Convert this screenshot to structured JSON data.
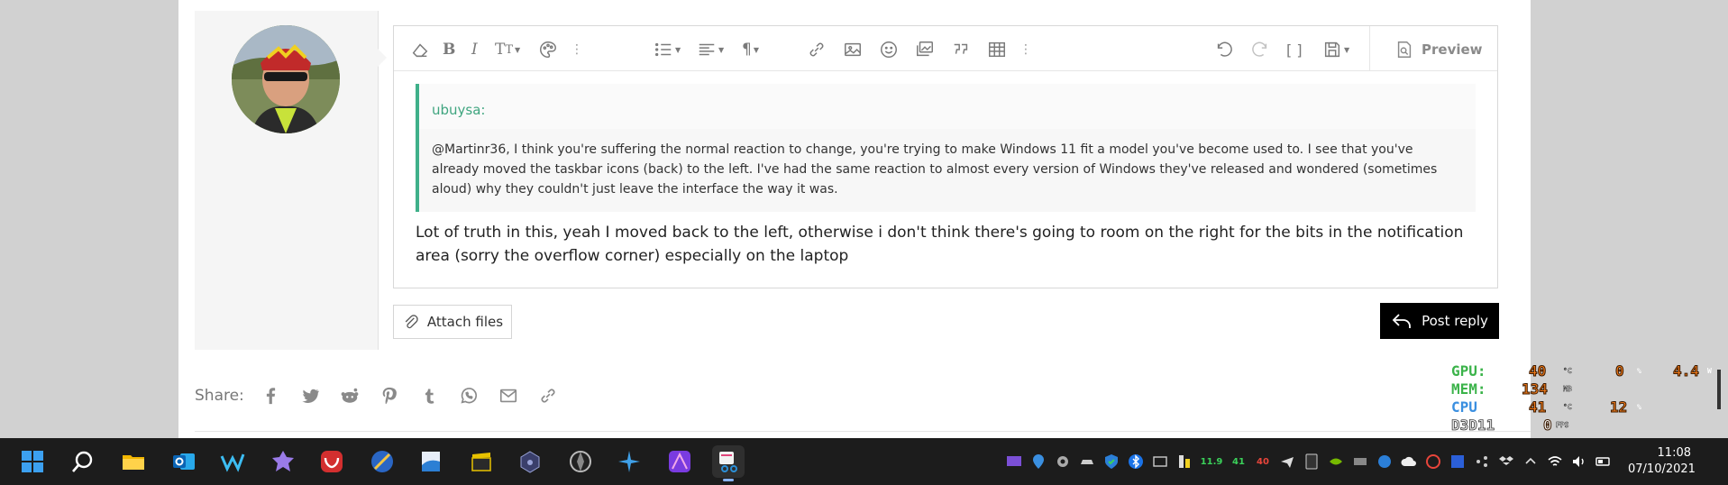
{
  "editor": {
    "preview_label": "Preview"
  },
  "quote": {
    "author": "ubuysa:",
    "text": "@Martinr36, I think you're suffering the normal reaction to change, you're trying to make Windows 11 fit a model you've become used to. I see that you've already moved the taskbar icons (back) to the left. I've had the same reaction to almost every version of Windows they've released and wondered (sometimes aloud) why they couldn't just leave the interface the way it was."
  },
  "reply": {
    "text": "Lot of truth in this, yeah I moved back to the left, otherwise i don't think there's going to room on the right for the bits in the notification area (sorry the overflow corner) especially on the laptop"
  },
  "actions": {
    "attach_label": "Attach files",
    "post_label": "Post reply"
  },
  "share": {
    "label": "Share:"
  },
  "overlay": {
    "gpu_label": "GPU:",
    "gpu_temp": "40",
    "gpu_temp_unit": "°C",
    "gpu_load": "0",
    "gpu_load_unit": "%",
    "gpu_power": "4.4",
    "gpu_power_unit": "W",
    "mem_label": "MEM:",
    "mem_value": "134",
    "mem_unit": "MB",
    "cpu_label": "CPU",
    "cpu_temp": "41",
    "cpu_temp_unit": "°C",
    "cpu_load": "12",
    "cpu_load_unit": "%",
    "api_label": "D3D11",
    "fps_value": "0",
    "fps_unit": "FPS",
    "colors": {
      "gpu": "#3bb34a",
      "mem": "#3bb34a",
      "cpu": "#3a8fe0",
      "value": "#f07a1a"
    }
  },
  "taskbar": {
    "apps": [
      "windows-start",
      "search",
      "file-explorer",
      "outlook",
      "waterfox",
      "affinity-photo-ext",
      "vivaldi",
      "ventoy",
      "pdf-maps",
      "director",
      "app-squares",
      "aperture",
      "krita-star",
      "affinity-designer",
      "snipping-tool"
    ],
    "tray_text": [
      "11.9",
      "41",
      "40"
    ],
    "time": "11:08",
    "date": "07/10/2021"
  }
}
